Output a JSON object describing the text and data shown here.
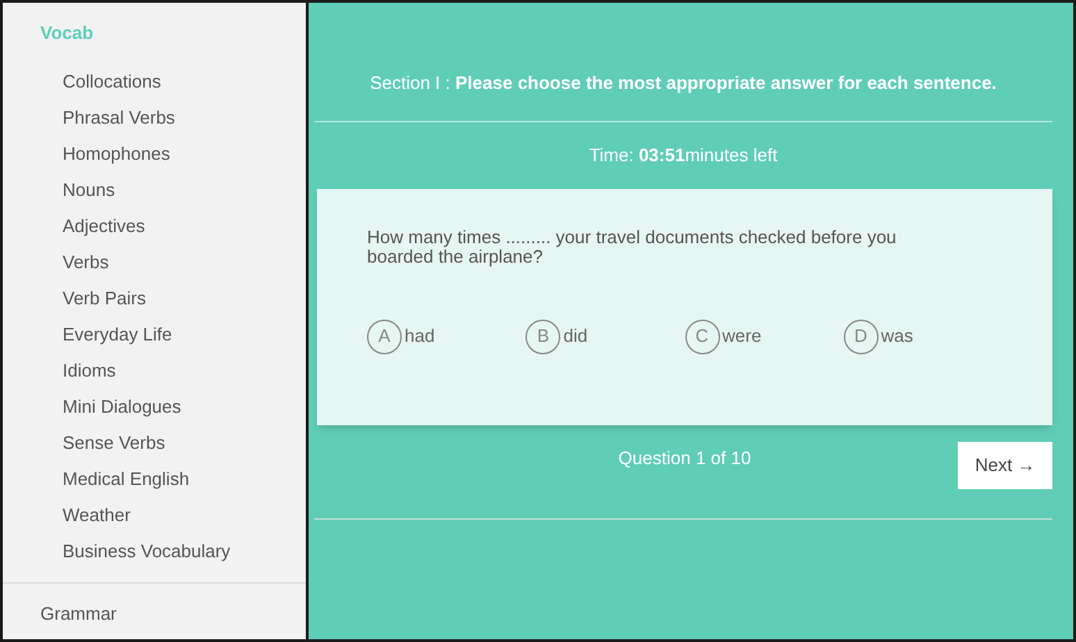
{
  "sidebar": {
    "sections": [
      {
        "label": "Vocab",
        "selected": true,
        "items": [
          {
            "label": "Collocations"
          },
          {
            "label": "Phrasal Verbs"
          },
          {
            "label": "Homophones"
          },
          {
            "label": "Nouns"
          },
          {
            "label": "Adjectives"
          },
          {
            "label": "Verbs"
          },
          {
            "label": "Verb Pairs"
          },
          {
            "label": "Everyday Life"
          },
          {
            "label": "Idioms"
          },
          {
            "label": "Mini Dialogues"
          },
          {
            "label": "Sense Verbs"
          },
          {
            "label": "Medical English"
          },
          {
            "label": "Weather"
          },
          {
            "label": "Business Vocabulary"
          }
        ]
      },
      {
        "label": "Grammar",
        "selected": false
      }
    ]
  },
  "quiz": {
    "section_heading": "Section I : **Please choose the most appropriate answer for each sentence.**",
    "timer": "Time: **03:51**minutes left",
    "question": "How many times ......... your travel documents checked before you boarded the airplane?",
    "options": [
      {
        "letter": "A",
        "text": "had",
        "selected": false
      },
      {
        "letter": "B",
        "text": "did",
        "selected": false
      },
      {
        "letter": "C",
        "text": "were",
        "selected": false
      },
      {
        "letter": "D",
        "text": "was",
        "selected": false
      }
    ],
    "progress": "Question 1 of 10",
    "next_button": "Next →"
  }
}
